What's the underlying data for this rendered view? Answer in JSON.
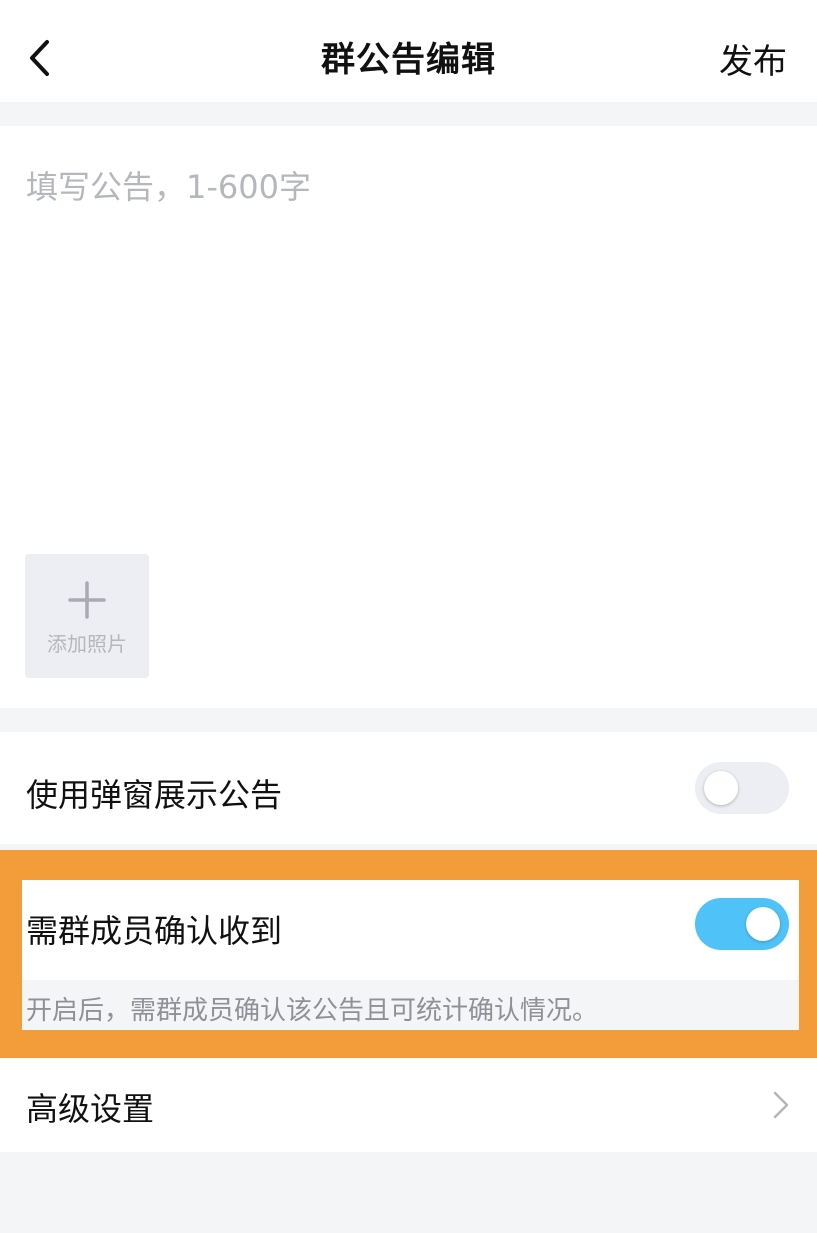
{
  "header": {
    "title": "群公告编辑",
    "publish_label": "发布",
    "back_icon": "chevron-left-icon"
  },
  "editor": {
    "placeholder": "填写公告，1-600字",
    "value": "",
    "add_photo_label": "添加照片",
    "add_photo_icon": "plus-icon"
  },
  "settings": {
    "popup": {
      "label": "使用弹窗展示公告",
      "enabled": false
    },
    "confirm": {
      "label": "需群成员确认收到",
      "enabled": true,
      "hint": "开启后，需群成员确认该公告且可统计确认情况。"
    },
    "advanced": {
      "label": "高级设置",
      "icon": "chevron-right-icon"
    }
  },
  "colors": {
    "toggle_on": "#4fc3f7",
    "toggle_off": "#eceef3",
    "highlight": "#f39c3a",
    "placeholder": "#b5b7bd"
  }
}
